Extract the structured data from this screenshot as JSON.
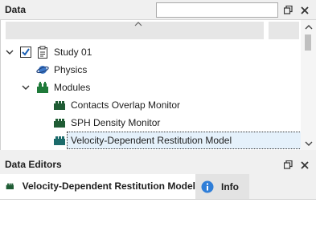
{
  "data_panel": {
    "title": "Data",
    "search": {
      "value": "",
      "placeholder": ""
    },
    "buttons": {
      "restore": "restore-icon",
      "close": "close-icon"
    }
  },
  "tree": {
    "items": [
      {
        "label": "Study 01",
        "icon": "study-clipboard-icon",
        "expanded": true,
        "checked": true
      },
      {
        "label": "Physics",
        "icon": "physics-planet-icon"
      },
      {
        "label": "Modules",
        "icon": "modules-blocks-icon",
        "expanded": true
      },
      {
        "label": "Contacts Overlap Monitor",
        "icon": "module-block-icon"
      },
      {
        "label": "SPH Density Monitor",
        "icon": "module-block-icon"
      },
      {
        "label": "Velocity-Dependent Restitution Model",
        "icon": "module-block-icon",
        "selected": true
      }
    ]
  },
  "editors_panel": {
    "title": "Data Editors",
    "tabs": [
      {
        "label": "Velocity-Dependent Restitution Model",
        "icon": "module-block-icon",
        "active": true
      },
      {
        "label": "Info",
        "icon": "info-icon",
        "active": false
      }
    ]
  },
  "colors": {
    "module_green": "#1f7a3a",
    "module_teal": "#1c6b6b",
    "checkbox_blue": "#1a5fb4",
    "info_blue": "#2f7ed8",
    "physics_blue": "#3c78c8"
  }
}
